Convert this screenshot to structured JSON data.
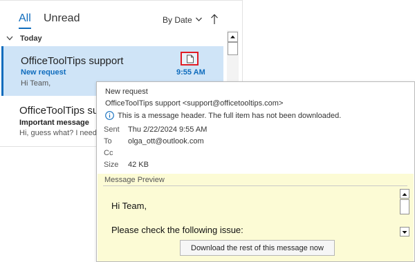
{
  "tabs": {
    "all": "All",
    "unread": "Unread"
  },
  "sort": {
    "label": "By Date"
  },
  "group": {
    "label": "Today"
  },
  "messages": [
    {
      "sender": "OfficeToolTips support",
      "subject": "New request",
      "preview": "Hi Team,",
      "time": "9:55 AM"
    },
    {
      "sender": "OfficeToolTips support",
      "subject": "Important message",
      "preview": "Hi, guess what?  I need"
    }
  ],
  "card": {
    "subject": "New request",
    "from": "OfficeToolTips support <support@officetooltips.com>",
    "info": "This is a message header. The full item has not been downloaded.",
    "fields": [
      {
        "label": "Sent",
        "value": "Thu 2/22/2024 9:55 AM"
      },
      {
        "label": "To",
        "value": "olga_ott@outlook.com"
      },
      {
        "label": "Cc",
        "value": ""
      },
      {
        "label": "Size",
        "value": "42 KB"
      }
    ],
    "preview_title": "Message Preview",
    "preview_lines": [
      "Hi Team,",
      "Please check the following issue:"
    ],
    "download_label": "Download the rest of this message now"
  },
  "colors": {
    "accent": "#0f6cbd",
    "selected_bg": "#cfe4f7",
    "preview_bg": "#fcfbd5",
    "highlight_border": "#e01b24"
  },
  "icons": [
    "chevron-down-icon",
    "sort-arrow-up-icon",
    "message-header-icon",
    "info-icon",
    "scroll-up-icon",
    "scroll-down-icon"
  ]
}
